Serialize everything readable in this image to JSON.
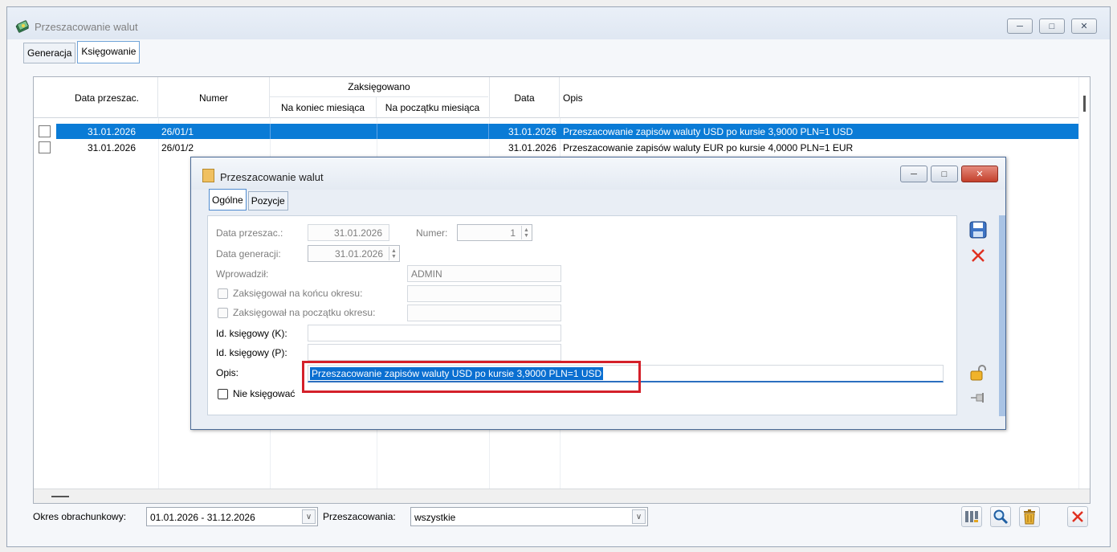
{
  "window": {
    "title": "Przeszacowanie walut",
    "tabs": [
      {
        "label": "Generacja",
        "access_key": "G"
      },
      {
        "label": "Księgowanie",
        "active": true
      }
    ],
    "caption_buttons": [
      "minimize",
      "restore",
      "close"
    ]
  },
  "grid": {
    "headers": {
      "data_przeszac": "Data przeszac.",
      "numer": "Numer",
      "zaksiegowano": "Zaksięgowano",
      "na_koniec": "Na koniec miesiąca",
      "na_poczatku": "Na początku miesiąca",
      "data": "Data",
      "opis": "Opis"
    },
    "rows": [
      {
        "data_przeszac": "31.01.2026",
        "numer": "26/01/1",
        "na_koniec": "",
        "na_poczatku": "",
        "data": "31.01.2026",
        "opis": "Przeszacowanie zapisów waluty USD po kursie 3,9000 PLN=1 USD",
        "selected": true
      },
      {
        "data_przeszac": "31.01.2026",
        "numer": "26/01/2",
        "na_koniec": "",
        "na_poczatku": "",
        "data": "31.01.2026",
        "opis": "Przeszacowanie zapisów waluty EUR po kursie 4,0000 PLN=1 EUR",
        "selected": false
      }
    ]
  },
  "filters": {
    "okres_label": "Okres obrachunkowy:",
    "okres_value": "01.01.2026 - 31.12.2026",
    "przeszacowania_label": "Przeszacowania:",
    "przeszacowania_value": "wszystkie"
  },
  "dialog": {
    "title": "Przeszacowanie walut",
    "tabs": [
      {
        "label": "Ogólne",
        "active": true
      },
      {
        "label": "Pozycje"
      }
    ],
    "fields": {
      "data_przeszac_label": "Data przeszac.:",
      "data_przeszac_value": "31.01.2026",
      "numer_label": "Numer:",
      "numer_value": "1",
      "data_generacji_label": "Data generacji:",
      "data_generacji_value": "31.01.2026",
      "wprowadzil_label": "Wprowadził:",
      "wprowadzil_value": "ADMIN",
      "zaks_koniec_label": "Zaksięgował na końcu okresu:",
      "zaks_koniec_value": "",
      "zaks_poczatek_label": "Zaksięgował na początku okresu:",
      "zaks_poczatek_value": "",
      "id_k_label": "Id. księgowy (K):",
      "id_k_value": "",
      "id_p_label": "Id. księgowy (P):",
      "id_p_value": "",
      "opis_label": "Opis:",
      "opis_value": "Przeszacowanie zapisów waluty USD po kursie 3,9000 PLN=1 USD",
      "nie_ksiegowac_label": "Nie księgować"
    }
  },
  "colors": {
    "selection": "#0a7bd6",
    "highlight_box": "#d4202a"
  }
}
